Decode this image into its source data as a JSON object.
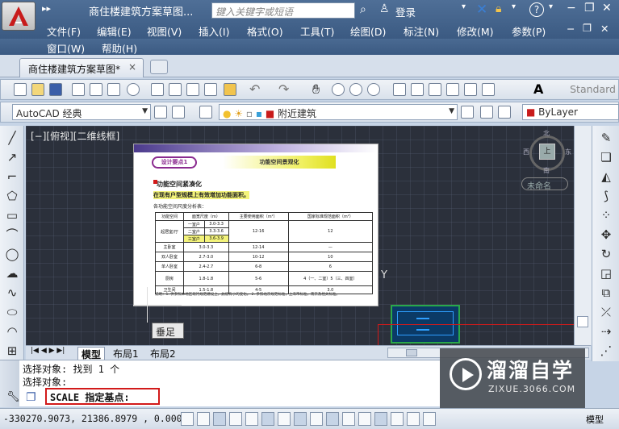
{
  "window": {
    "title": "商住楼建筑方案草图...",
    "search_placeholder": "键入关键字或短语",
    "login": "登录"
  },
  "menus": [
    "文件(F)",
    "编辑(E)",
    "视图(V)",
    "插入(I)",
    "格式(O)",
    "工具(T)",
    "绘图(D)",
    "标注(N)",
    "修改(M)",
    "参数(P)",
    "窗口(W)",
    "帮助(H)"
  ],
  "doc_tab": {
    "label": "商住楼建筑方案草图*",
    "close": "×"
  },
  "toolbar": {
    "style_combo": "Standard",
    "workspace": "AutoCAD 经典",
    "layer": "附近建筑",
    "color": "ByLayer"
  },
  "canvas": {
    "view_label": "[−][俯视][二维线框]",
    "viewcube_top": "上",
    "viewcube_n": "北",
    "viewcube_s": "南",
    "viewcube_w": "西",
    "viewcube_e": "东",
    "unnamed": "未命名",
    "tooltip": "垂足",
    "y_axis": "Y"
  },
  "document": {
    "header_left": "设计要点1",
    "header_right": "功能空间景观化",
    "heading": "功能空间紧凑化",
    "subtitle": "在现有户型规模上有效增加功能面积。",
    "sub2": "各功能空间尺度分析表：",
    "table_headers": [
      "功能空间",
      "面宽尺度（m）",
      "主要使用面积（m²）",
      "国家标准规范面积（m²）"
    ],
    "table_rows": [
      [
        "起居室/厅",
        "一室户",
        "3.0-3.3",
        "12-16",
        "12"
      ],
      [
        "",
        "二室户",
        "3.3-3.6",
        "",
        ""
      ],
      [
        "",
        "三室户",
        "3.6-3.9",
        "",
        ""
      ],
      [
        "主卧室",
        "3.0-3.3",
        "",
        "12-14",
        "—"
      ],
      [
        "双人卧室",
        "2.7-3.0",
        "",
        "10-12",
        "10"
      ],
      [
        "单人卧室",
        "2.4-2.7",
        "",
        "6-8",
        "6"
      ],
      [
        "厨房",
        "1.8-1.8",
        "",
        "5-6",
        "4（一、二室）5（三、四室）"
      ],
      [
        "卫生间",
        "1.5-1.8",
        "",
        "4-5",
        "3.0"
      ]
    ],
    "note": "说明：1. 供参照本地区现行规范建设上，此值有小的变化。 2. 参照北京规范标准，上海市标准，南京及相关标准。"
  },
  "layout_tabs": [
    "模型",
    "布局1",
    "布局2"
  ],
  "command": {
    "line1": "选择对象: 找到 1 个",
    "line2": "选择对象:",
    "prompt": "SCALE 指定基点:"
  },
  "status": {
    "coords": "-330270.9073, 21386.8979 , 0.0000",
    "model": "模型"
  },
  "watermark": {
    "title": "溜溜自学",
    "sub": "ZIXUE.3066.COM"
  },
  "colors": {
    "titlebar": "#3b5a82",
    "canvas": "#2b303b",
    "highlight": "#d21a1a"
  }
}
